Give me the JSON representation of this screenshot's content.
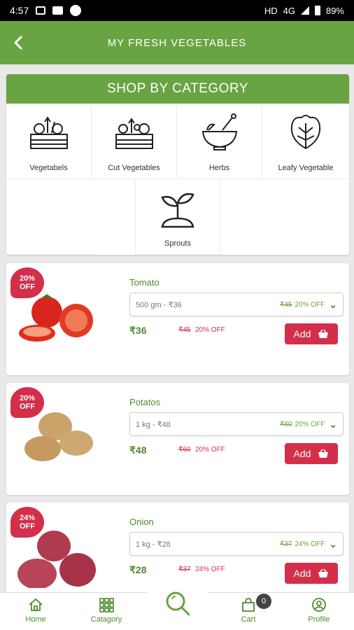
{
  "status_bar": {
    "time": "4:57",
    "network": "HD",
    "signal": "4G",
    "battery": "89%"
  },
  "app_bar": {
    "back_icon": "chevron-left-icon",
    "title": "MY FRESH VEGETABLES"
  },
  "category": {
    "header": "SHOP BY CATEGORY",
    "items": [
      {
        "label": "Vegetabels",
        "icon": "vegetable-crate-icon"
      },
      {
        "label": "Cut Vegetables",
        "icon": "cut-vegetable-crate-icon"
      },
      {
        "label": "Herbs",
        "icon": "mortar-pestle-icon"
      },
      {
        "label": "Leafy Vegetable",
        "icon": "leafy-vegetable-icon"
      },
      {
        "label": "Sprouts",
        "icon": "sprout-icon"
      }
    ]
  },
  "products": [
    {
      "name": "Tomato",
      "badge_pct": "20%",
      "badge_off": "OFF",
      "variant": "500 gm - ₹36",
      "variant_old": "₹45",
      "variant_off": "20% OFF",
      "price": "₹36",
      "old_price": "₹45",
      "off": "20% OFF",
      "add_label": "Add"
    },
    {
      "name": "Potatos",
      "badge_pct": "20%",
      "badge_off": "OFF",
      "variant": "1 kg - ₹48",
      "variant_old": "₹60",
      "variant_off": "20% OFF",
      "price": "₹48",
      "old_price": "₹60",
      "off": "20% OFF",
      "add_label": "Add"
    },
    {
      "name": "Onion",
      "badge_pct": "24%",
      "badge_off": "OFF",
      "variant": "1 kg - ₹28",
      "variant_old": "₹37",
      "variant_off": "24% OFF",
      "price": "₹28",
      "old_price": "₹37",
      "off": "24% OFF",
      "add_label": "Add"
    }
  ],
  "bottom_nav": {
    "home": "Home",
    "category": "Catagory",
    "cart": "Cart",
    "cart_count": "0",
    "profile": "Profile"
  },
  "colors": {
    "primary_green": "#69a442",
    "dark_green": "#4f8a2f",
    "accent_red": "#d32f4a"
  }
}
